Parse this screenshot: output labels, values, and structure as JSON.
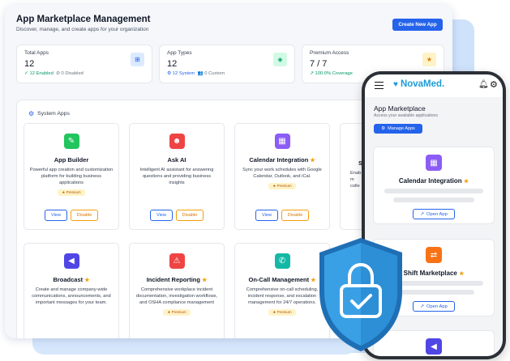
{
  "desktop": {
    "title": "App Marketplace Management",
    "subtitle": "Discover, manage, and create apps for your organization",
    "create_button": "Create New App"
  },
  "stats": [
    {
      "label": "Total Apps",
      "value": "12",
      "meta_a": "✓ 12 Enabled",
      "meta_b": "⊘ 0 Disabled",
      "icon": "grid-icon"
    },
    {
      "label": "App Types",
      "value": "12",
      "meta_a": "⚙ 12 System",
      "meta_b": "👥 0 Custom",
      "icon": "cube-icon"
    },
    {
      "label": "Premium Access",
      "value": "7 / 7",
      "meta_a": "↗ 100.0% Coverage",
      "meta_b": "",
      "icon": "star-icon"
    }
  ],
  "apps_section": {
    "title": "System Apps",
    "view_label": "View",
    "disable_label": "Disable",
    "premium_label": "★ Premium"
  },
  "apps": [
    {
      "name": "App Builder",
      "desc": "Powerful app creation and customization platform for building business applications",
      "premium": true,
      "starred": false,
      "color": "#22c55e",
      "icon": "hammer-icon",
      "glyph": "✎"
    },
    {
      "name": "Ask AI",
      "desc": "Intelligent AI assistant for answering questions and providing business insights",
      "premium": false,
      "starred": false,
      "color": "#ef4444",
      "icon": "robot-icon",
      "glyph": "☻"
    },
    {
      "name": "Calendar Integration",
      "desc": "Sync your work schedules with Google Calendar, Outlook, and iCal.",
      "premium": true,
      "starred": true,
      "color": "#8b5cf6",
      "icon": "calendar-icon",
      "glyph": "▦"
    },
    {
      "name": "S",
      "desc": "Enab\nm\ncolle",
      "premium": false,
      "starred": false,
      "color": "#f97316",
      "icon": "swap-icon",
      "glyph": "⇄"
    },
    {
      "name": "Broadcast",
      "desc": "Create and manage company-wide communications, announcements, and important messages for your team.",
      "premium": false,
      "starred": true,
      "color": "#4f46e5",
      "icon": "megaphone-icon",
      "glyph": "📢"
    },
    {
      "name": "Incident Reporting",
      "desc": "Comprehensive workplace incident documentation, investigation workflows, and OSHA compliance management",
      "premium": true,
      "starred": true,
      "color": "#ef4444",
      "icon": "warning-icon",
      "glyph": "⚠"
    },
    {
      "name": "On-Call Management",
      "desc": "Comprehensive on-call scheduling, incident response, and escalation management for 24/7 operations.",
      "premium": true,
      "starred": true,
      "color": "#14b8a6",
      "icon": "phone-icon",
      "glyph": "✆"
    }
  ],
  "phone": {
    "brand": "NovaMed.",
    "title": "App Marketplace",
    "subtitle": "Access your available applications",
    "manage_button": "Manage Apps",
    "open_label": "Open App",
    "cards": [
      {
        "name": "Calendar Integration",
        "color": "#8b5cf6",
        "icon": "calendar-icon",
        "glyph": "▦"
      },
      {
        "name": "Shift Marketplace",
        "color": "#f97316",
        "icon": "swap-icon",
        "glyph": "⇄"
      },
      {
        "name": "",
        "color": "#4f46e5",
        "icon": "megaphone-icon",
        "glyph": "📢"
      }
    ]
  },
  "colors": {
    "accent": "#2563eb",
    "premium": "#f59e0b",
    "shield": "#2b8fd8"
  }
}
